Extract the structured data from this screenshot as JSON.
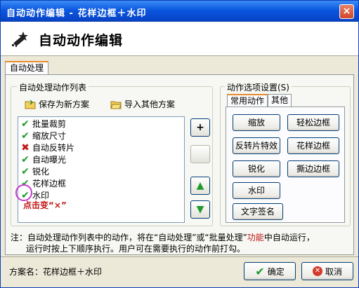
{
  "window": {
    "title": "自动动作编辑 - 花样边框＋水印",
    "close": "×"
  },
  "header": {
    "title": "自动动作编辑"
  },
  "tabs": {
    "main": "自动处理"
  },
  "left_group": {
    "legend": "自动处理动作列表",
    "save_scheme": "保存为新方案",
    "import_scheme": "导入其他方案",
    "items": [
      {
        "label": "批量裁剪",
        "state": "check"
      },
      {
        "label": "缩放尺寸",
        "state": "check"
      },
      {
        "label": "自动反转片",
        "state": "cross"
      },
      {
        "label": "自动曝光",
        "state": "check"
      },
      {
        "label": "锐化",
        "state": "check"
      },
      {
        "label": "花样边框",
        "state": "check"
      },
      {
        "label": "水印",
        "state": "check"
      }
    ],
    "hint": "点击变“×”",
    "add_btn": "+",
    "up_btn": "▲",
    "down_btn": "▼"
  },
  "right_group": {
    "legend": "动作选项设置(S)",
    "tab_common": "常用动作",
    "tab_other": "其他",
    "buttons": [
      "缩放",
      "轻松边框",
      "反转片特效",
      "花样边框",
      "锐化",
      "撕边边框",
      "水印",
      "文字签名"
    ]
  },
  "note": {
    "line1_pre": "注：自动处理动作列表中的动作，将在“自动处理”或“批量处理”",
    "line1_hl": "功能",
    "line1_post": "中自动运行，",
    "line2": "运行时按上下顺序执行。用户可在需要执行的动作前打勾。"
  },
  "footer": {
    "scheme": "方案名：花样边框＋水印",
    "ok": "确定",
    "cancel": "取消"
  },
  "colors": {
    "title_blue": "#0a56df",
    "check_green": "#1f9a2a",
    "cross_red": "#c01818",
    "highlight_circle": "#c23bd1"
  }
}
